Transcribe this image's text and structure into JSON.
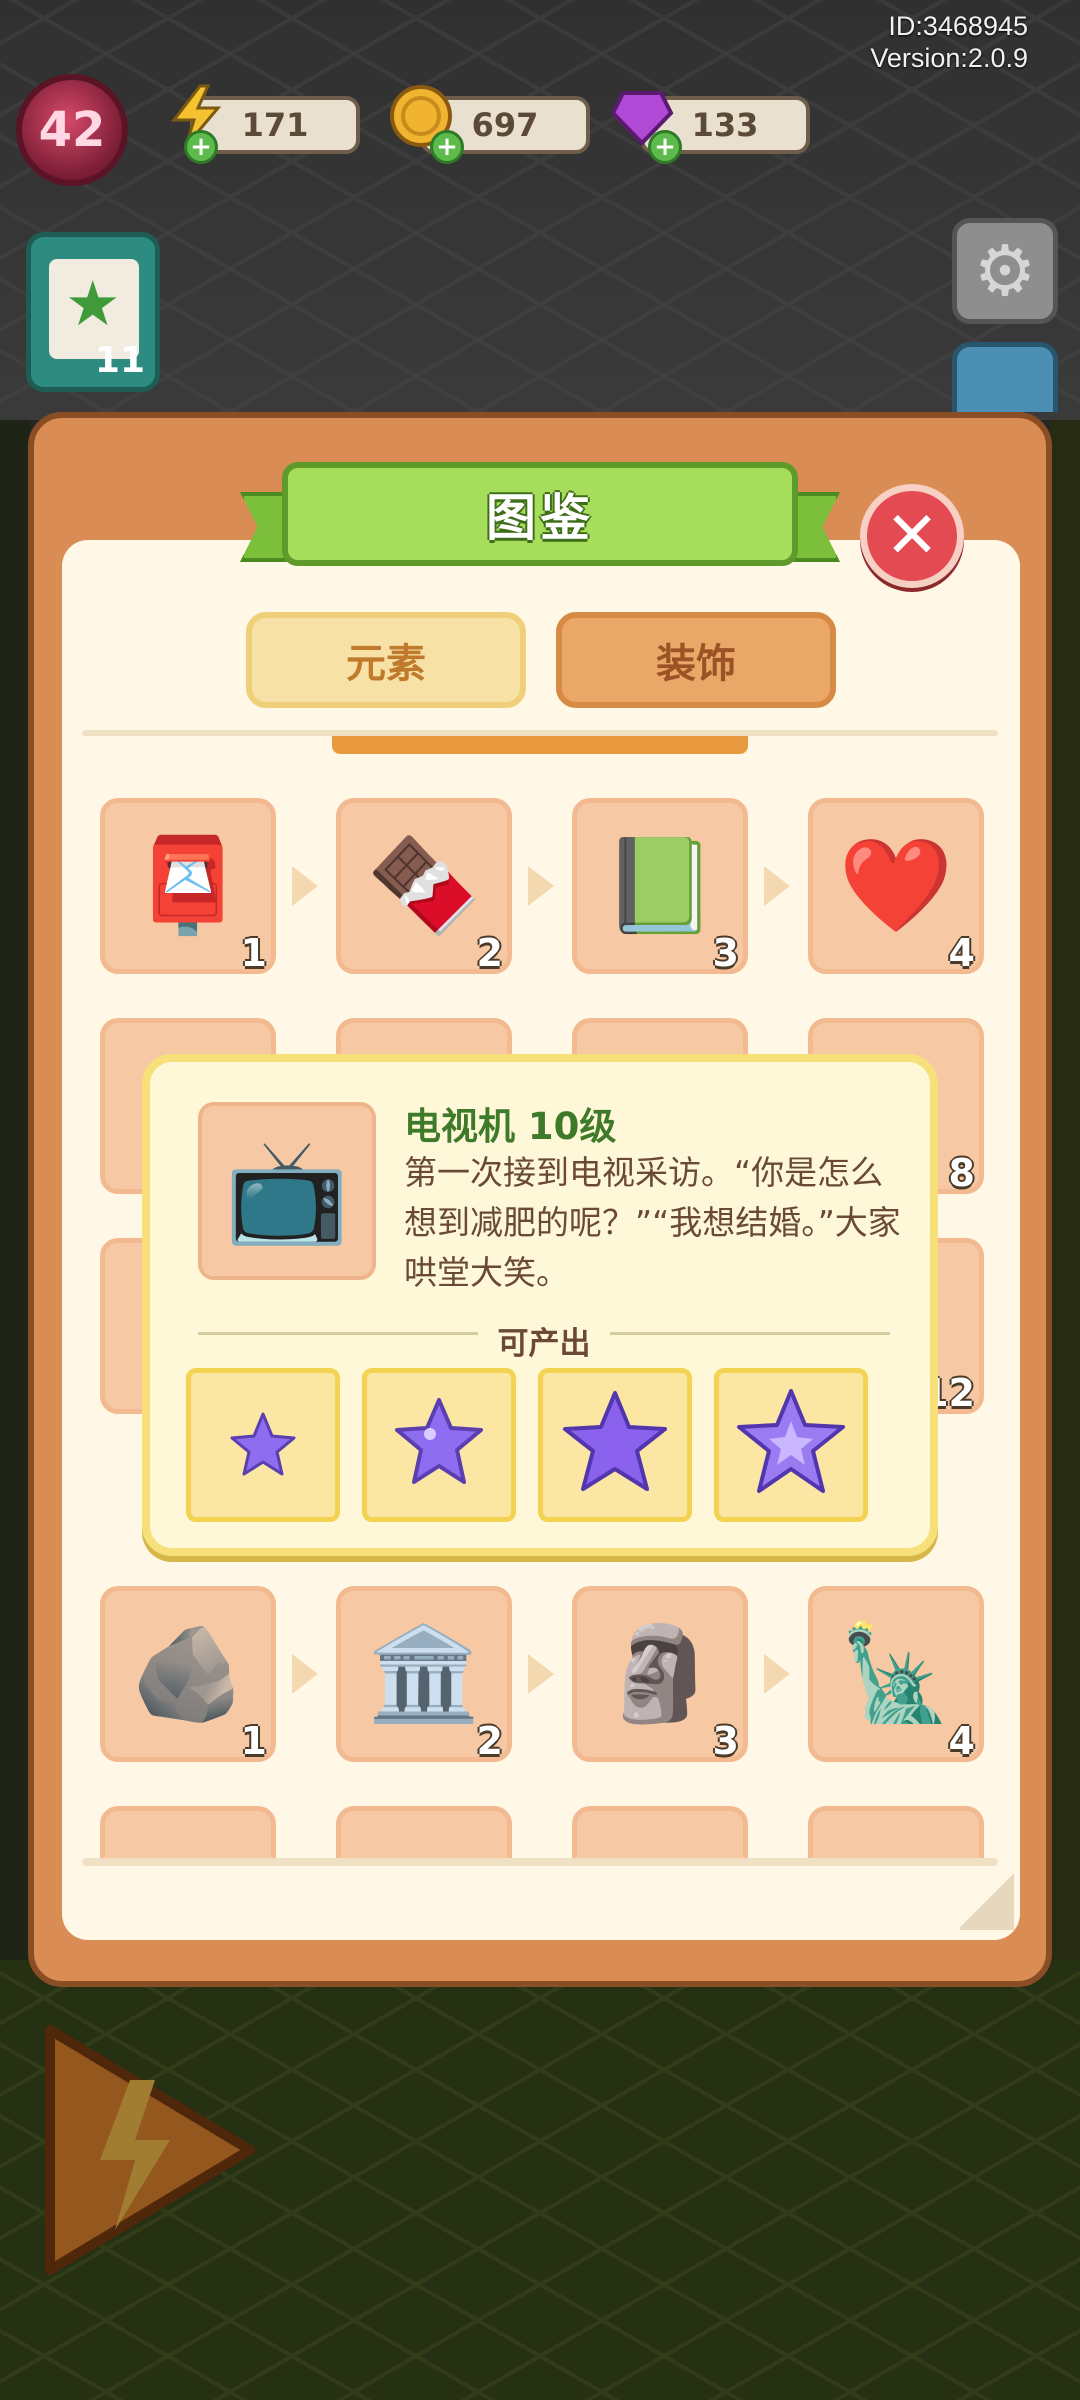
{
  "hud": {
    "player_id": "ID:3468945",
    "version": "Version:2.0.9",
    "level": "42",
    "energy": "171",
    "coins": "697",
    "gems": "133",
    "quest_count": "11"
  },
  "codex": {
    "title": "图鉴",
    "tabs": [
      {
        "label": "元素",
        "selected": true
      },
      {
        "label": "装饰",
        "selected": false
      }
    ],
    "rows": [
      [
        {
          "icon": "mailbox-icon",
          "level": "1"
        },
        {
          "icon": "chocolate-bar-icon",
          "level": "2"
        },
        {
          "icon": "sketchbook-icon",
          "level": "3"
        },
        {
          "icon": "bandaged-heart-icon",
          "level": "4"
        }
      ],
      [
        {
          "icon": "leaf-item-icon",
          "level": ""
        },
        {
          "icon": "round-item-icon",
          "level": ""
        },
        {
          "icon": "blank-item-icon",
          "level": ""
        },
        {
          "icon": "egg-item-icon",
          "level": "8"
        }
      ],
      [
        {
          "icon": "hidden-item-icon",
          "level": ""
        },
        {
          "icon": "hidden-item-icon",
          "level": ""
        },
        {
          "icon": "hidden-item-icon",
          "level": ""
        },
        {
          "icon": "hidden-item-icon",
          "level": "12"
        }
      ],
      [
        {
          "icon": "mossy-rock-icon",
          "level": "1"
        },
        {
          "icon": "mossy-pillar-icon",
          "level": "2"
        },
        {
          "icon": "statue-bust-icon",
          "level": "3"
        },
        {
          "icon": "warrior-statue-icon",
          "level": "4"
        }
      ],
      [
        {
          "icon": "cloud-item-icon",
          "level": ""
        },
        {
          "icon": "cloud-item-icon",
          "level": ""
        },
        {
          "icon": "cloud-item-icon",
          "level": ""
        },
        {
          "icon": "cloud-item-icon",
          "level": ""
        }
      ]
    ]
  },
  "popup": {
    "icon": "tv-duck-icon",
    "title": "电视机  10级",
    "description": "第一次接到电视采访。“你是怎么想到减肥的呢？”“我想结婚。”大家哄堂大笑。",
    "produces_label": "可产出",
    "products": [
      {
        "icon": "purple-star-small-icon"
      },
      {
        "icon": "purple-star-round-icon"
      },
      {
        "icon": "purple-star-icon"
      },
      {
        "icon": "purple-star-sparkle-icon"
      }
    ]
  },
  "colors": {
    "panel": "#d98c53",
    "panel_border": "#8b4d24",
    "inner": "#fff8e7",
    "ribbon": "#a6dd5a",
    "close": "#e44a51",
    "slot": "#f6c9a4",
    "popup_border": "#f7e07a",
    "star_purple": "#8f6df0"
  }
}
